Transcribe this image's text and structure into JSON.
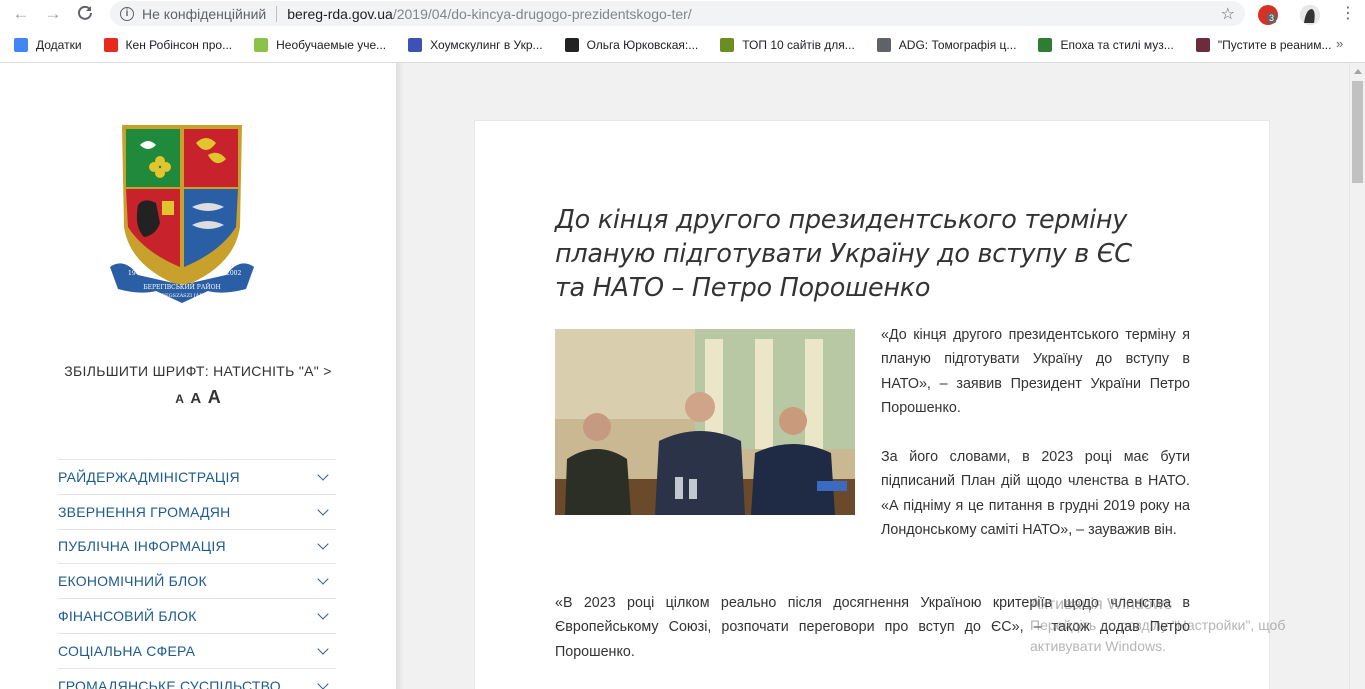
{
  "browser": {
    "security_label": "Не конфіденційний",
    "url_host": "bereg-rda.gov.ua",
    "url_path": "/2019/04/do-kincya-drugogo-prezidentskogo-ter/",
    "extension_badge": "3",
    "bookmarks": [
      {
        "label": "Додатки",
        "icon": "apps-grid-icon",
        "color": "#4285f4"
      },
      {
        "label": "Кен Робінсон про...",
        "icon": "ted-t-icon",
        "color": "#e62b1e"
      },
      {
        "label": "Необучаемые уче...",
        "icon": "sun-icon",
        "color": "#8bc34a"
      },
      {
        "label": "Хоумскулинг в Укр...",
        "icon": "palette-icon",
        "color": "#3f51b5"
      },
      {
        "label": "Ольга Юрковская:...",
        "icon": "spiral-icon",
        "color": "#222222"
      },
      {
        "label": "ТОП 10 сайтів для...",
        "icon": "book-icon",
        "color": "#6b8e23"
      },
      {
        "label": "ADG: Томографія ц...",
        "icon": "page-icon",
        "color": "#5f6368"
      },
      {
        "label": "Епоха та стилі муз...",
        "icon": "mountain-icon",
        "color": "#2e7d32"
      },
      {
        "label": "\"Пустите в реаним...",
        "icon": "zh-icon",
        "color": "#6d2c3e"
      }
    ]
  },
  "sidebar": {
    "crest_ribbon_text": "БЕРЕГІВСЬКИЙ РАЙОН",
    "crest_ribbon_text2": "BEREGSZÁSZI JÁRÁS",
    "crest_year_left": "1945",
    "crest_year_right": "2002",
    "font_size_label": "ЗБІЛЬШИТИ ШРИФТ: НАТИСНІТЬ \"А\" >",
    "font_size_letters": [
      "A",
      "A",
      "A"
    ],
    "menu": [
      "РАЙДЕРЖАДМІНІСТРАЦІЯ",
      "ЗВЕРНЕННЯ ГРОМАДЯН",
      "ПУБЛІЧНА ІНФОРМАЦІЯ",
      "ЕКОНОМІЧНИЙ БЛОК",
      "ФІНАНСОВИЙ БЛОК",
      "СОЦІАЛЬНА СФЕРА",
      "ГРОМАДЯНСЬКЕ СУСПІЛЬСТВО"
    ]
  },
  "article": {
    "title": "До кінця другого президентського терміну планую підготувати Україну до вступу в ЄС та НАТО – Петро Порошенко",
    "p1": "«До кінця другого президентського терміну я планую підготувати Україну до вступу в НАТО», – заявив Президент України Петро Порошенко.",
    "p2": "За його словами, в 2023 році має бути підписаний План дій щодо членства в НАТО. «А підніму я це питання в грудні 2019 року на Лондонському саміті НАТО», – зауважив він.",
    "p3": "«В 2023 році цілком реально після досягнення Україною критеріїв щодо членства в Європейському Союзі, розпочати переговори про вступ до ЄС», – також додав Петро Порошенко."
  },
  "watermark": {
    "line1": "Активація Windows",
    "line2": "Перейдіть до розділу \"Настройки\", щоб",
    "line3": "активувати Windows."
  }
}
